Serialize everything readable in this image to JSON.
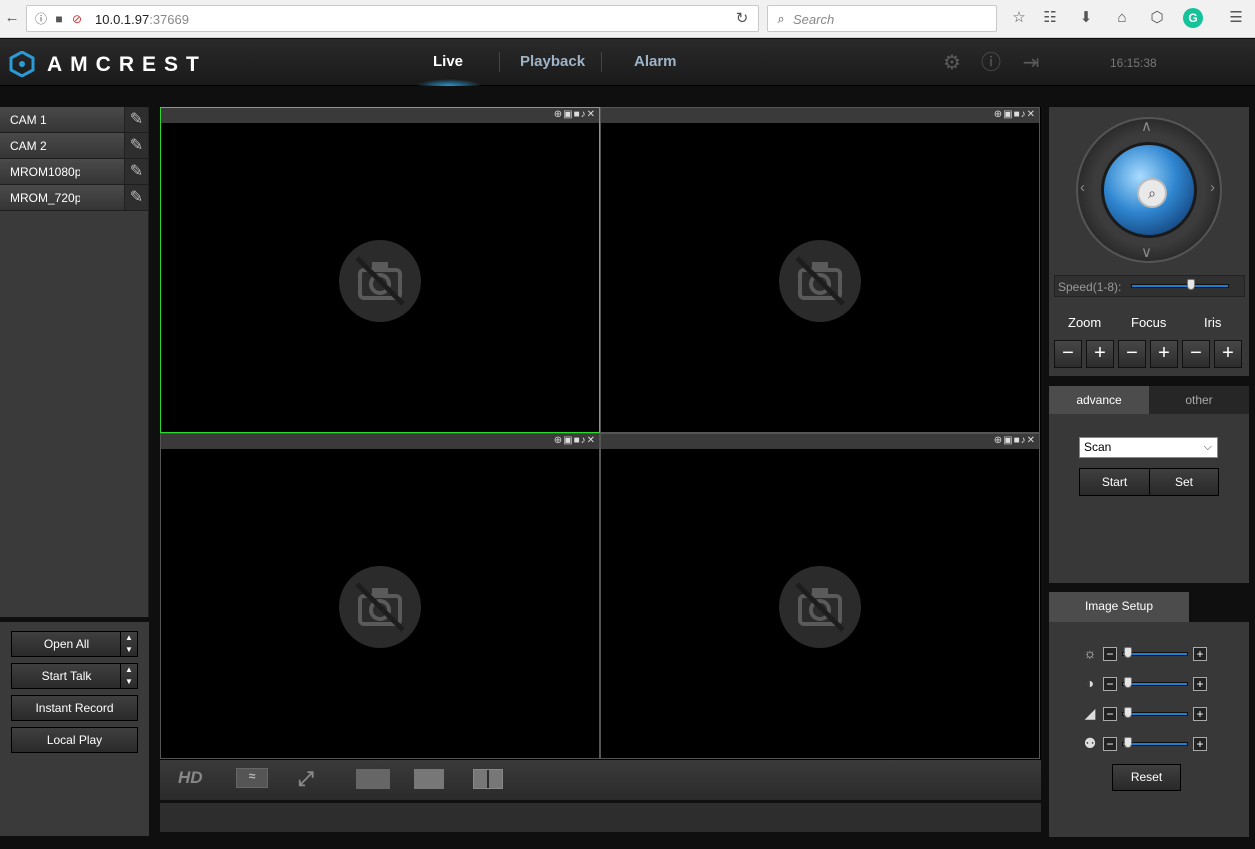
{
  "browser": {
    "url_host": "10.0.1.97",
    "url_port": ":37669",
    "search_placeholder": "Search"
  },
  "header": {
    "brand": "AMCREST",
    "nav": [
      "Live",
      "Playback",
      "Alarm"
    ],
    "active_nav": "Live",
    "clock": "16:15:38",
    "accent_color": "#2a9bd6"
  },
  "sidebar": {
    "cameras": [
      "CAM 1",
      "CAM 2",
      "MROM1080p",
      "MROM_720p"
    ],
    "buttons": {
      "open_all": "Open All",
      "start_talk": "Start Talk",
      "instant_record": "Instant Record",
      "local_play": "Local Play"
    }
  },
  "video": {
    "layout": "2x2",
    "selected_cell": 0,
    "selected_color": "#2ed82e",
    "cells": [
      "no-camera-icon",
      "no-camera-icon",
      "no-camera-icon",
      "no-camera-icon"
    ]
  },
  "toolbar": {
    "hd_label": "HD"
  },
  "ptz": {
    "speed_label": "Speed(1-8):",
    "speed_value": 5,
    "labels": [
      "Zoom",
      "Focus",
      "Iris"
    ]
  },
  "advance": {
    "tabs": [
      "advance",
      "other"
    ],
    "active_tab": "advance",
    "mode": "Scan",
    "start_label": "Start",
    "set_label": "Set"
  },
  "image_setup": {
    "title": "Image Setup",
    "rows": [
      "brightness-icon",
      "contrast-icon",
      "saturation-icon",
      "hue-icon"
    ],
    "reset_label": "Reset"
  }
}
